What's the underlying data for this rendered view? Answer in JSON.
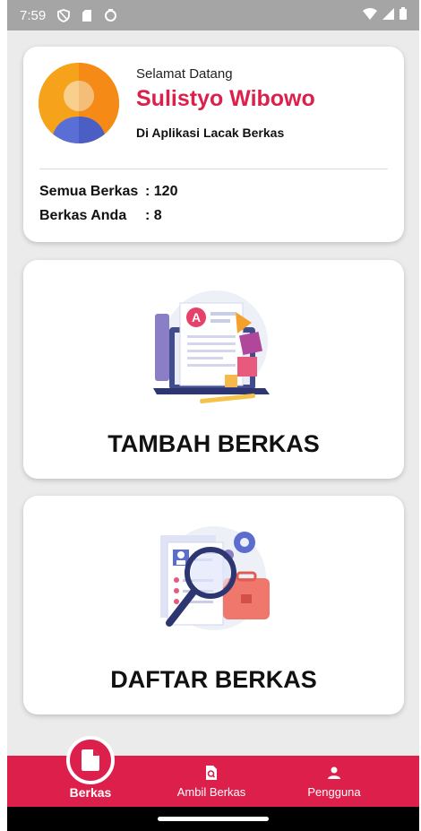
{
  "status_bar": {
    "time": "7:59",
    "icons": [
      "vpn-icon",
      "sd-card-icon",
      "sync-icon"
    ],
    "right_icons": [
      "wifi-icon",
      "signal-icon",
      "battery-icon"
    ]
  },
  "profile": {
    "greeting": "Selamat Datang",
    "name": "Sulistyo Wibowo",
    "app_line": "Di Aplikasi Lacak Berkas",
    "stats": [
      {
        "label": "Semua Berkas",
        "value": ": 120"
      },
      {
        "label": "Berkas Anda",
        "value": ": 8"
      }
    ]
  },
  "actions": {
    "add": {
      "label": "TAMBAH BERKAS",
      "icon": "document-laptop-illustration"
    },
    "list": {
      "label": "DAFTAR BERKAS",
      "icon": "search-documents-illustration"
    }
  },
  "bottom_nav": {
    "items": [
      {
        "label": "Berkas",
        "icon": "file-icon",
        "active": true
      },
      {
        "label": "Ambil Berkas",
        "icon": "file-search-icon",
        "active": false
      },
      {
        "label": "Pengguna",
        "icon": "user-icon",
        "active": false
      }
    ]
  },
  "colors": {
    "accent": "#dc1f4b",
    "background": "#ebebeb",
    "card": "#ffffff",
    "status_bar": "#a5a5a5"
  }
}
